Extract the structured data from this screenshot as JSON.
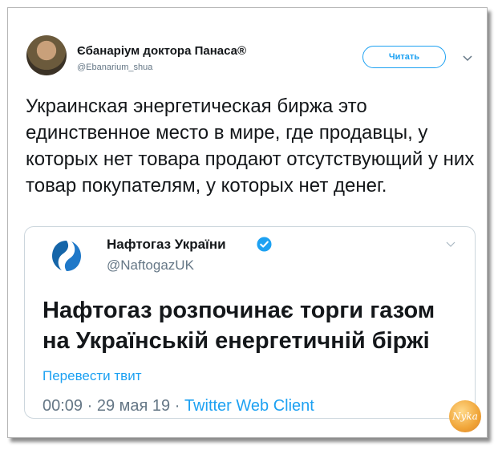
{
  "tweet": {
    "author_name": "Єбанаріум доктора Панаса®",
    "author_handle": "@Ebanarium_shua",
    "follow_label": "Читать",
    "text": "Украинская энергетическая биржа это единственное место в мире, где продавцы, у которых нет товара продают отсутствующий у них товар покупателям, у которых нет денег."
  },
  "quoted": {
    "name": "Нафтогаз України",
    "handle": "@NaftogazUK",
    "text": "Нафтогаз розпочинає торги газом на Українській енергетичній біржі",
    "translate_label": "Перевести твит",
    "time": "00:09",
    "date": "29 мая 19",
    "client": "Twitter Web Client"
  },
  "watermark": {
    "text": "Nyka"
  },
  "colors": {
    "accent": "#1da1f2",
    "text": "#14171a",
    "muted": "#657786"
  }
}
